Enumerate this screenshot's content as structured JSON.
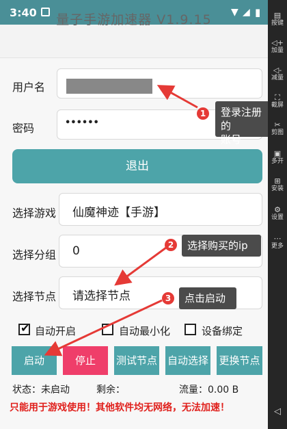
{
  "status_bar": {
    "time": "3:40"
  },
  "app": {
    "title": "量子手游加速器 V1.9.15"
  },
  "form": {
    "username_label": "用户名",
    "password_label": "密码",
    "password_value": "••••••",
    "logout_label": "退出",
    "game_label": "选择游戏",
    "game_value": "仙魔神迹【手游】",
    "group_label": "选择分组",
    "group_value": "0",
    "node_label": "选择节点",
    "node_value": "请选择节点"
  },
  "options": {
    "auto_start": {
      "label": "自动开启",
      "checked": true
    },
    "auto_minimize": {
      "label": "自动最小化",
      "checked": false
    },
    "device_bind": {
      "label": "设备绑定",
      "checked": false
    }
  },
  "buttons": {
    "start": "启动",
    "stop": "停止",
    "test_node": "测试节点",
    "auto_select": "自动选择",
    "change_node": "更换节点"
  },
  "info": {
    "status": "状态：未启动",
    "remaining": "剩余：",
    "traffic": "流量：0.00 B"
  },
  "warning": "只能用于游戏使用！其他软件均无网络，无法加速！",
  "annotations": [
    {
      "number": "1",
      "text_line1": "登录注册的",
      "text_line2": "账号"
    },
    {
      "number": "2",
      "text": "选择购买的ip"
    },
    {
      "number": "3",
      "text": "点击启动"
    }
  ],
  "sidebar": [
    {
      "icon": "▤",
      "label": "按键"
    },
    {
      "icon": "◁+",
      "label": "加量"
    },
    {
      "icon": "◁-",
      "label": "减量"
    },
    {
      "icon": "⛶",
      "label": "截屏"
    },
    {
      "icon": "✂",
      "label": "剪图"
    },
    {
      "icon": "▣",
      "label": "多开"
    },
    {
      "icon": "⊞",
      "label": "安装"
    },
    {
      "icon": "⚙",
      "label": "设置"
    },
    {
      "icon": "⋯",
      "label": "更多"
    }
  ],
  "colors": {
    "accent": "#4da4a9",
    "stop": "#ef3e6a",
    "warning": "#e0201c",
    "annotation_red": "#e53a36"
  }
}
